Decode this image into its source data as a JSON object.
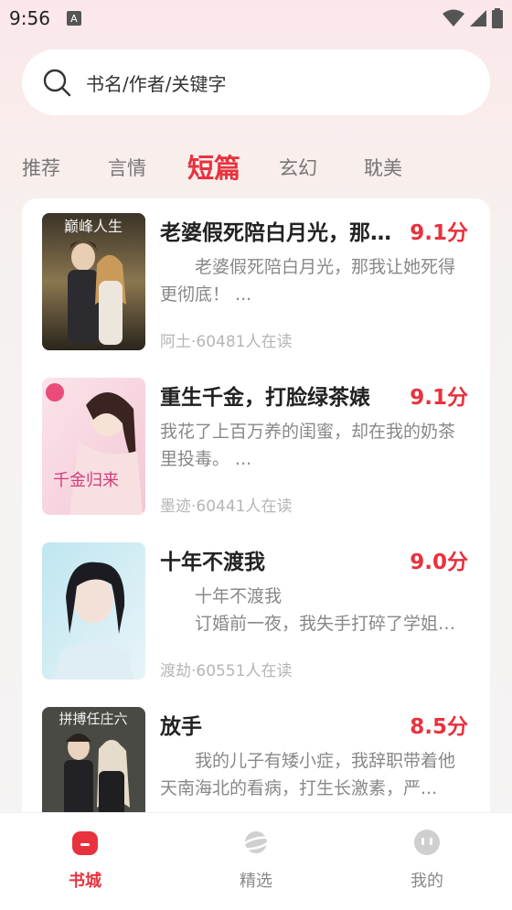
{
  "status_bar": {
    "time": "9:56",
    "notif_letter": "A"
  },
  "search": {
    "placeholder": "书名/作者/关键字"
  },
  "tabs": [
    {
      "label": "推荐",
      "active": false
    },
    {
      "label": "言情",
      "active": false
    },
    {
      "label": "短篇",
      "active": true
    },
    {
      "label": "玄幻",
      "active": false
    },
    {
      "label": "耽美",
      "active": false
    }
  ],
  "books": [
    {
      "title": "老婆假死陪白月光，那我让她死得更彻底！",
      "score": "9.1分",
      "desc": "　　老婆假死陪白月光，那我让她死得更彻底！ ...",
      "meta": "阿土·60481人在读",
      "cover_text": "巅峰人生"
    },
    {
      "title": "重生千金，打脸绿茶婊",
      "score": "9.1分",
      "desc": "我花了上百万养的闺蜜，却在我的奶茶里投毒。 ...",
      "meta": "墨迹·60441人在读",
      "cover_text": "千金归来"
    },
    {
      "title": "十年不渡我",
      "score": "9.0分",
      "desc": "　　十年不渡我\n　　订婚前一夜，我失手打碎了学姐的...",
      "meta": "渡劫·60551人在读",
      "cover_text": ""
    },
    {
      "title": "放手",
      "score": "8.5分",
      "desc": "　　我的儿子有矮小症，我辞职带着他天南海北的看病，打生长激素，严...",
      "meta": "",
      "cover_text": "拼搏任庄六"
    }
  ],
  "nav": [
    {
      "label": "书城",
      "active": true,
      "icon": "bookstore-icon"
    },
    {
      "label": "精选",
      "active": false,
      "icon": "planet-icon"
    },
    {
      "label": "我的",
      "active": false,
      "icon": "profile-face-icon"
    }
  ],
  "colors": {
    "accent": "#e8323e",
    "muted": "#888888"
  }
}
